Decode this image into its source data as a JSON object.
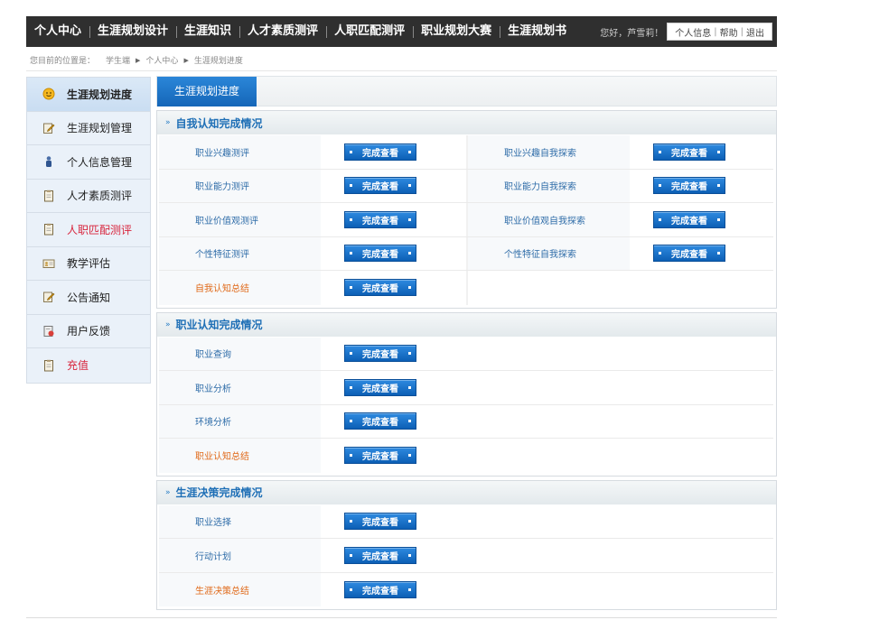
{
  "nav": {
    "items": [
      "个人中心",
      "生涯规划设计",
      "生涯知识",
      "人才素质测评",
      "人职匹配测评",
      "职业规划大赛",
      "生涯规划书"
    ],
    "greeting": "您好，芦雪莉！",
    "user_links": [
      "个人信息",
      "帮助",
      "退出"
    ]
  },
  "breadcrumb": {
    "prefix": "您目前的位置是：",
    "items": [
      "学生端",
      "个人中心",
      "生涯规划进度"
    ]
  },
  "sidebar": {
    "items": [
      {
        "label": "生涯规划进度",
        "icon": "smiley-icon"
      },
      {
        "label": "生涯规划管理",
        "icon": "edit-icon"
      },
      {
        "label": "个人信息管理",
        "icon": "person-icon"
      },
      {
        "label": "人才素质测评",
        "icon": "clipboard-icon"
      },
      {
        "label": "人职匹配测评",
        "icon": "clipboard-icon"
      },
      {
        "label": "教学评估",
        "icon": "card-icon"
      },
      {
        "label": "公告通知",
        "icon": "edit-icon"
      },
      {
        "label": "用户反馈",
        "icon": "feedback-icon"
      },
      {
        "label": "充值",
        "icon": "clipboard-icon"
      }
    ]
  },
  "main": {
    "tab": "生涯规划进度",
    "button_label": "完成查看",
    "sections": [
      {
        "title": "自我认知完成情况",
        "rows": [
          {
            "left": "职业兴趣测评",
            "right": "职业兴趣自我探索"
          },
          {
            "left": "职业能力测评",
            "right": "职业能力自我探索"
          },
          {
            "left": "职业价值观测评",
            "right": "职业价值观自我探索"
          },
          {
            "left": "个性特征测评",
            "right": "个性特征自我探索"
          },
          {
            "left": "自我认知总结",
            "right": null
          }
        ]
      },
      {
        "title": "职业认知完成情况",
        "rows": [
          {
            "left": "职业查询"
          },
          {
            "left": "职业分析"
          },
          {
            "left": "环境分析"
          },
          {
            "left": "职业认知总结"
          }
        ]
      },
      {
        "title": "生涯决策完成情况",
        "rows": [
          {
            "left": "职业选择"
          },
          {
            "left": "行动计划"
          },
          {
            "left": "生涯决策总结"
          }
        ]
      }
    ]
  },
  "colors": {
    "nav_bg": "#2f2f2f",
    "accent_blue": "#1566b8",
    "summary_orange": "#e06a1a",
    "sidebar_red": "#d8243c"
  }
}
